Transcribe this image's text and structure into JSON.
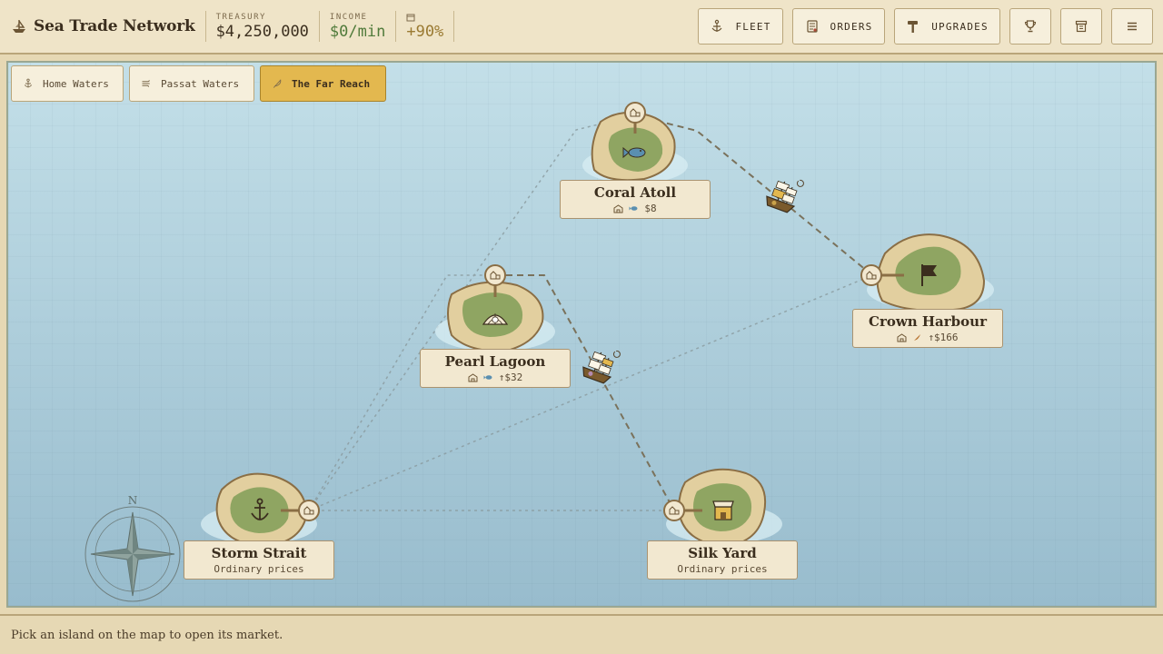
{
  "app": {
    "title": "Sea Trade Network",
    "brand_icon": "ship-icon"
  },
  "stats": {
    "treasury_label": "TREASURY",
    "treasury_value": "$4,250,000",
    "income_label": "INCOME",
    "income_value": "$0/min",
    "bonus_icon": "crate-icon",
    "bonus_value": "+90%"
  },
  "toolbar": {
    "fleet": "FLEET",
    "orders": "ORDERS",
    "upgrades": "UPGRADES"
  },
  "tabs": [
    {
      "label": "Home Waters",
      "icon": "anchor-icon",
      "active": false
    },
    {
      "label": "Passat Waters",
      "icon": "wind-icon",
      "active": false
    },
    {
      "label": "The Far Reach",
      "icon": "feather-icon",
      "active": true
    }
  ],
  "islands": {
    "coral": {
      "name": "Coral Atoll",
      "sub": "$8",
      "goods_icon": "fish-icon"
    },
    "crown": {
      "name": "Crown Harbour",
      "sub": "↑$166",
      "goods_icon": "spice-icon"
    },
    "pearl": {
      "name": "Pearl Lagoon",
      "sub": "↑$32",
      "goods_icon": "fish-icon"
    },
    "storm": {
      "name": "Storm Strait",
      "sub": "Ordinary prices"
    },
    "silk": {
      "name": "Silk Yard",
      "sub": "Ordinary prices"
    }
  },
  "compass_label": "N",
  "status": "Pick an island on the map to open its market.",
  "colors": {
    "parchment": "#efe4c8",
    "accent": "#e3b84f",
    "sea": "#a9cad8",
    "land": "#e2cf9f",
    "forest": "#8fa562",
    "income_green": "#4f7a3a"
  }
}
